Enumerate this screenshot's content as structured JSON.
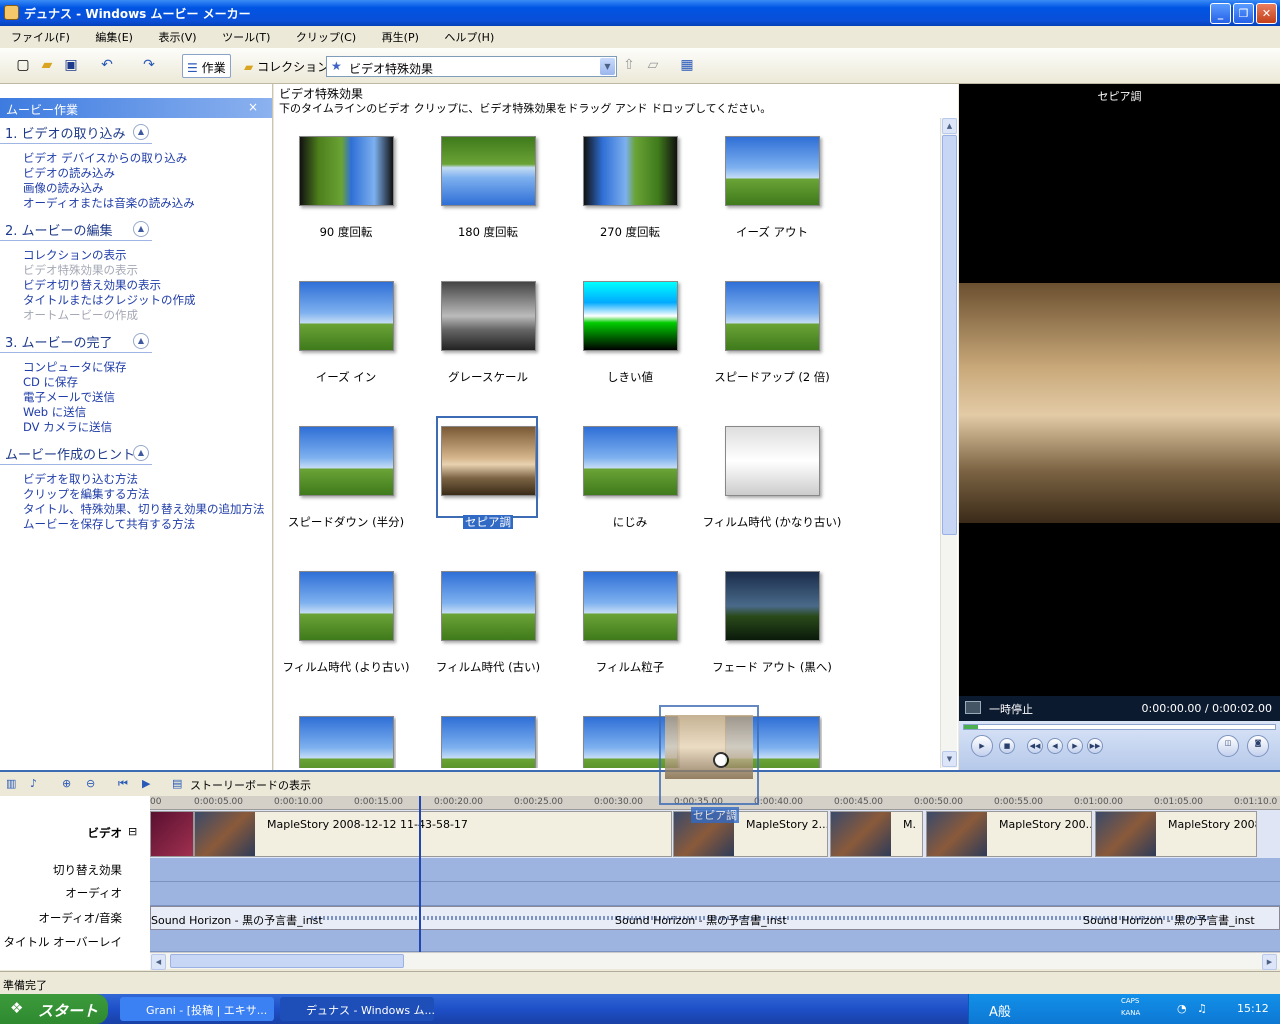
{
  "window": {
    "title": "デュナス - Windows ムービー メーカー"
  },
  "menu": [
    "ファイル(F)",
    "編集(E)",
    "表示(V)",
    "ツール(T)",
    "クリップ(C)",
    "再生(P)",
    "ヘルプ(H)"
  ],
  "toolbar": {
    "task_label": "作業",
    "collection_label": "コレクション",
    "collection_select": "ビデオ特殊効果"
  },
  "taskpane": {
    "header": "ムービー作業",
    "close": "×",
    "sections": [
      {
        "title": "1. ビデオの取り込み",
        "links": [
          "ビデオ デバイスからの取り込み",
          "ビデオの読み込み",
          "画像の読み込み",
          "オーディオまたは音楽の読み込み"
        ]
      },
      {
        "title": "2. ムービーの編集",
        "links": [
          "コレクションの表示",
          "ビデオ特殊効果の表示",
          "ビデオ切り替え効果の表示",
          "タイトルまたはクレジットの作成",
          "オートムービーの作成"
        ]
      },
      {
        "title": "3. ムービーの完了",
        "links": [
          "コンピュータに保存",
          "CD に保存",
          "電子メールで送信",
          "Web に送信",
          "DV カメラに送信"
        ]
      },
      {
        "title": "ムービー作成のヒント",
        "links": [
          "ビデオを取り込む方法",
          "クリップを編集する方法",
          "タイトル、特殊効果、切り替え効果の追加方法",
          "ムービーを保存して共有する方法"
        ]
      }
    ],
    "disabled_links": [
      "ビデオ特殊効果の表示",
      "オートムービーの作成"
    ]
  },
  "effects": {
    "title": "ビデオ特殊効果",
    "subtitle": "下のタイムラインのビデオ クリップに、ビデオ特殊効果をドラッグ アンド ドロップしてください。",
    "items": [
      "90 度回転",
      "180 度回転",
      "270 度回転",
      "イーズ アウト",
      "イーズ イン",
      "グレースケール",
      "しきい値",
      "スピードアップ (2 倍)",
      "スピードダウン (半分)",
      "セピア調",
      "にじみ",
      "フィルム時代 (かなり古い)",
      "フィルム時代 (より古い)",
      "フィルム時代 (古い)",
      "フィルム粒子",
      "フェード アウト (黒へ)"
    ],
    "selected": "セピア調",
    "drag_label": "セピア調"
  },
  "preview": {
    "title": "セピア調",
    "status": "一時停止",
    "time": "0:00:00.00 / 0:00:02.00"
  },
  "timeline": {
    "storyboard_label": "ストーリーボードの表示",
    "tracks": [
      "ビデオ",
      "切り替え効果",
      "オーディオ",
      "オーディオ/音楽",
      "タイトル オーバーレイ"
    ],
    "ruler": [
      "00",
      "0:00:05.00",
      "0:00:10.00",
      "0:00:15.00",
      "0:00:20.00",
      "0:00:25.00",
      "0:00:30.00",
      "0:00:35.00",
      "0:00:40.00",
      "0:00:45.00",
      "0:00:50.00",
      "0:00:55.00",
      "0:01:00.00",
      "0:01:05.00",
      "0:01:10.0"
    ],
    "clips": [
      "MapleStory 2008-12-12 11-43-58-17",
      "MapleStory 2...",
      "M.",
      "MapleStory 200...",
      "MapleStory 2008-"
    ],
    "audio_clips": [
      "Sound Horizon - 黒の予言書_inst",
      "Sound Horizon - 黒の予言書_inst",
      "Sound Horizon - 黒の予言書_inst"
    ]
  },
  "status": "準備完了",
  "taskbar": {
    "start": "スタート",
    "tasks": [
      "Grani - [投稿 | エキサ...",
      "デュナス - Windows ム..."
    ],
    "tray_caps": "CAPS",
    "tray_kana": "KANA",
    "ime": "A般",
    "clock": "15:12"
  }
}
